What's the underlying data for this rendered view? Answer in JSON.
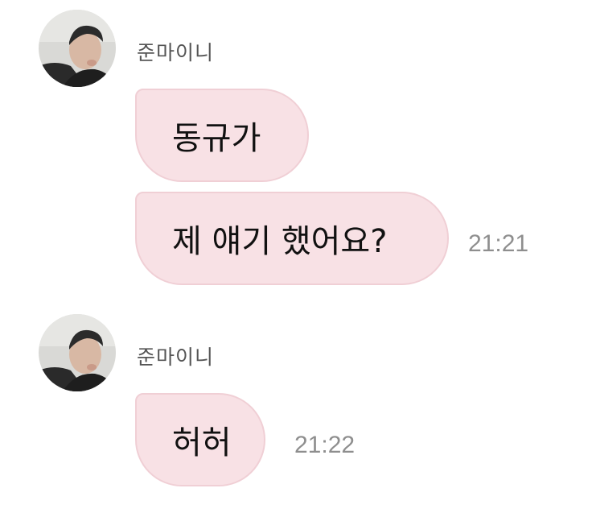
{
  "chat": {
    "groups": [
      {
        "sender": "준마이니",
        "avatar_icon": "profile-photo-icon",
        "messages": [
          {
            "text": "동규가",
            "time": ""
          },
          {
            "text": "제 얘기 했어요?",
            "time": "21:21"
          }
        ]
      },
      {
        "sender": "준마이니",
        "avatar_icon": "profile-photo-icon",
        "messages": [
          {
            "text": "허허",
            "time": "21:22"
          }
        ]
      }
    ]
  },
  "colors": {
    "bubble_fill": "#f8e1e5",
    "bubble_border": "#f0cfd5",
    "timestamp": "#8e8e8e",
    "sender_name": "#555555"
  }
}
